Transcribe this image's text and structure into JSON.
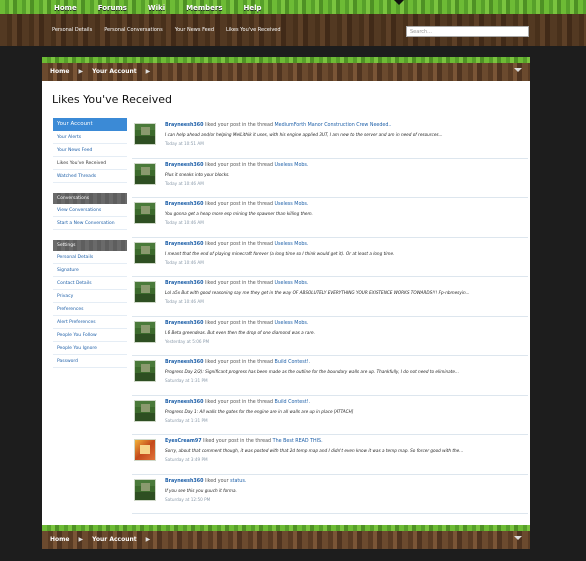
{
  "topnav": [
    "Home",
    "Forums",
    "Wiki",
    "Members",
    "Help"
  ],
  "subnav": [
    "Personal Details",
    "Personal Conversations",
    "Your News Feed",
    "Likes You've Received"
  ],
  "search": {
    "placeholder": "Search..."
  },
  "breadcrumb": {
    "home": "Home",
    "account": "Your Account",
    "separator": "▶"
  },
  "page": {
    "title": "Likes You've Received"
  },
  "sidebar": {
    "account_head": "Your Account",
    "account_items": [
      "Your Alerts",
      "Your News Feed",
      "Likes You've Received",
      "Watched Threads"
    ],
    "conv_head": "Conversations",
    "conv_items": [
      "View Conversations",
      "Start a New Conversation"
    ],
    "settings_head": "Settings",
    "settings_items": [
      "Personal Details",
      "Signature",
      "Contact Details",
      "Privacy",
      "Preferences",
      "Alert Preferences",
      "People You Follow",
      "People You Ignore",
      "Password"
    ]
  },
  "feed": [
    {
      "user": "Brayneesh360",
      "action": "liked your post in the thread",
      "thread": "MediumForth Manor Construction Crew Needed..",
      "snippet": "I can help ahead and/or helping MelLithik it uses, with his engine applied 3UT, I am new to the server and am in need of resources...",
      "time": "Today at 10:51 AM",
      "avatar": "minecraft"
    },
    {
      "user": "Brayneesh360",
      "action": "liked your post in the thread",
      "thread": "Useless Mobs.",
      "snippet": "Plus it sneaks into your blocks.",
      "time": "Today at 10:46 AM",
      "avatar": "minecraft"
    },
    {
      "user": "Brayneesh360",
      "action": "liked your post in the thread",
      "thread": "Useless Mobs.",
      "snippet": "You gonna get a heap more esp mining the spawner than killing them.",
      "time": "Today at 10:46 AM",
      "avatar": "minecraft"
    },
    {
      "user": "Brayneesh360",
      "action": "liked your post in the thread",
      "thread": "Useless Mobs.",
      "snippet": "I meant that the end of playing minecraft forever (a long time so I think would get it). Or at least a long time.",
      "time": "Today at 10:46 AM",
      "avatar": "minecraft"
    },
    {
      "user": "Brayneesh360",
      "action": "liked your post in the thread",
      "thread": "Useless Mobs.",
      "snippet": "Lol a5x But with good reasoning say me they get in the way OF ABSOLUTELY EVERYTHING YOUR EXISTENCE WORKS TOWARDS!!! Fp-nbmesyin...",
      "time": "Today at 10:46 AM",
      "avatar": "minecraft"
    },
    {
      "user": "Brayneesh360",
      "action": "liked your post in the thread",
      "thread": "Useless Mobs.",
      "snippet": "I.6 Beta greendeas. But even then the drop of one diamond was a rare.",
      "time": "Yesterday at 5:06 PM",
      "avatar": "minecraft"
    },
    {
      "user": "Brayneesh360",
      "action": "liked your post in the thread",
      "thread": "Build Contest!.",
      "snippet": "Progress Day 2/2): Significant progress has been made as the outline for the boundary walls are up. Thankfully, I do not need to eliminate...",
      "time": "Saturday at 1:31 PM",
      "avatar": "minecraft"
    },
    {
      "user": "Brayneesh360",
      "action": "liked your post in the thread",
      "thread": "Build Contest!.",
      "snippet": "Progress Day 1: All walls the gates for the engine are in all walls are up in place [ATTACH]",
      "time": "Saturday at 1:31 PM",
      "avatar": "minecraft"
    },
    {
      "user": "EyesCream97",
      "action": "liked your post in the thread",
      "thread": "The Best READ THIS.",
      "snippet": "Sorry, about that comment though, it was posted with that 2d temp map and I didn't even know it was a temp map. So forcer good with the...",
      "time": "Saturday at 3:49 PM",
      "avatar": "alt"
    },
    {
      "user": "Brayneesh360",
      "action": "liked your",
      "thread": "status.",
      "snippet": "If you see this you guuch it forma.",
      "time": "Saturday at 12:50 PM",
      "avatar": "minecraft"
    }
  ]
}
